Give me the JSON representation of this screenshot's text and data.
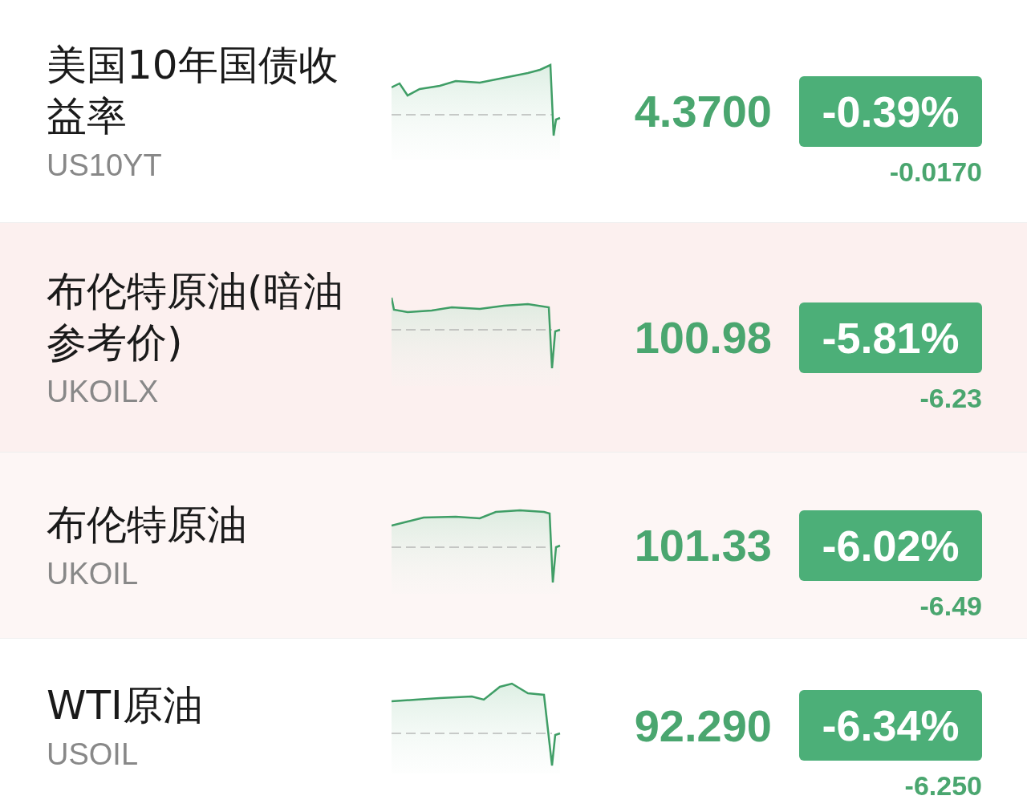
{
  "quotes": [
    {
      "name": "美国10年国债收益率",
      "symbol": "US10YT",
      "price": "4.3700",
      "change_percent": "-0.39%",
      "change": "-0.0170",
      "color": "#ffffff"
    },
    {
      "name": "布伦特原油(暗油参考价)",
      "symbol": "UKOILX",
      "price": "100.98",
      "change_percent": "-5.81%",
      "change": "-6.23",
      "color": "#fcf0ef"
    },
    {
      "name": "布伦特原油",
      "symbol": "UKOIL",
      "price": "101.33",
      "change_percent": "-6.02%",
      "change": "-6.49",
      "color": "#fdf6f5"
    },
    {
      "name": "WTI原油",
      "symbol": "USOIL",
      "price": "92.290",
      "change_percent": "-6.34%",
      "change": "-6.250",
      "color": "#ffffff"
    }
  ]
}
